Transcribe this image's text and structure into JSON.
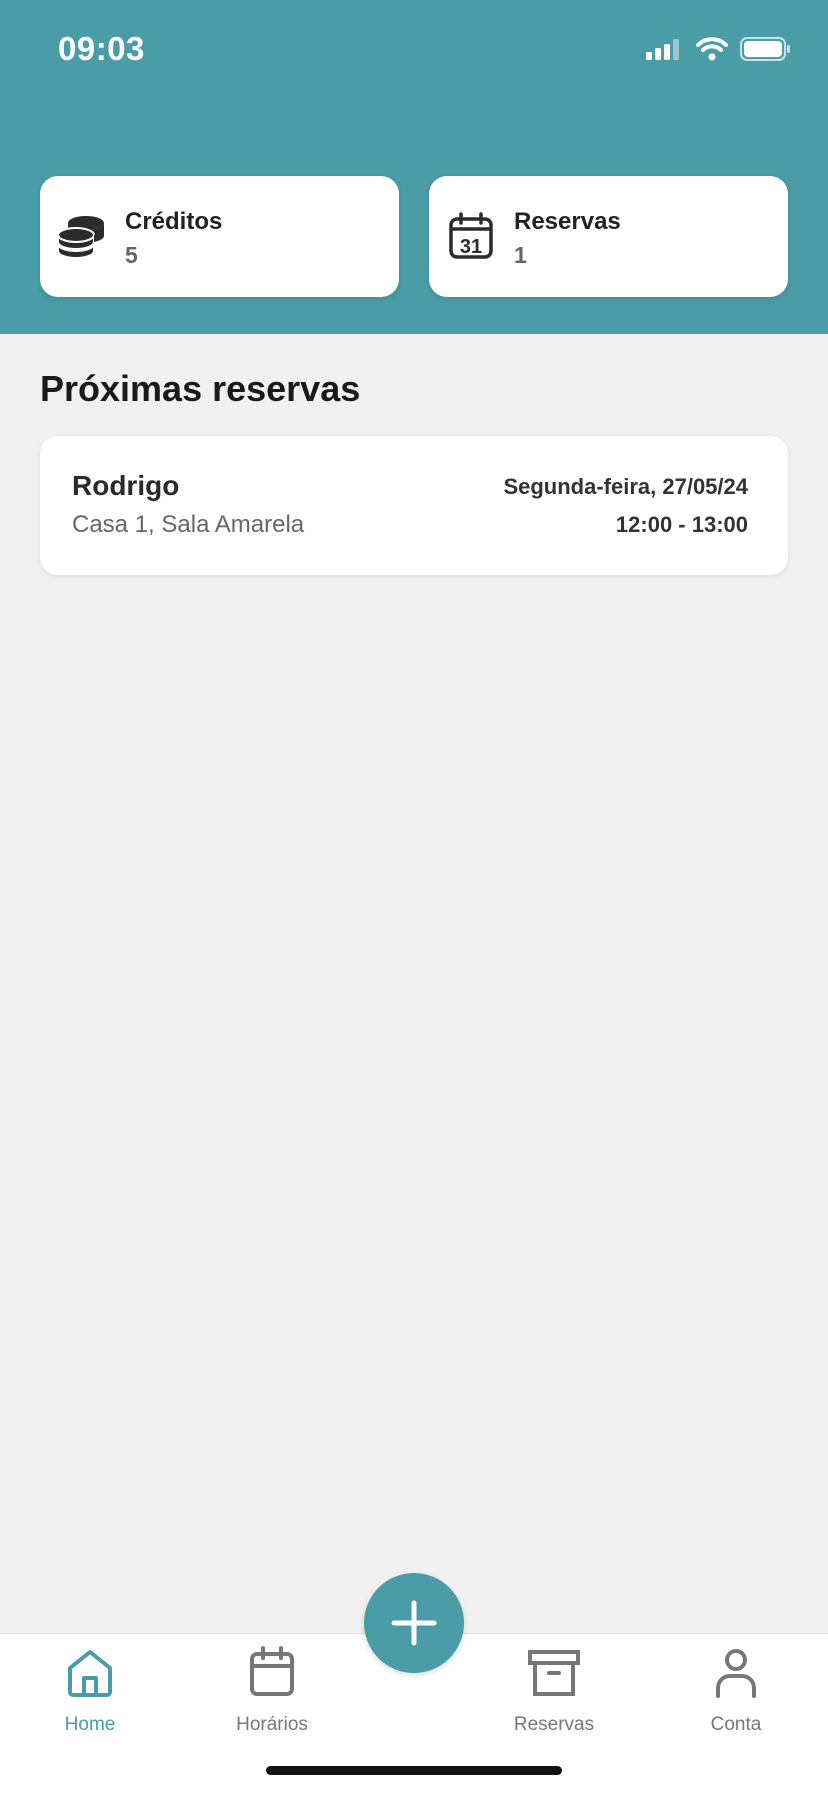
{
  "status_bar": {
    "time": "09:03"
  },
  "summary": {
    "credits": {
      "label": "Créditos",
      "value": "5",
      "icon": "coins-stack-icon"
    },
    "bookings": {
      "label": "Reservas",
      "value": "1",
      "icon": "calendar-31-icon"
    }
  },
  "section": {
    "title": "Próximas reservas"
  },
  "upcoming": [
    {
      "name": "Rodrigo",
      "place": "Casa 1, Sala Amarela",
      "date": "Segunda-feira, 27/05/24",
      "time": "12:00 - 13:00"
    }
  ],
  "tabbar": {
    "items": [
      {
        "label": "Home",
        "icon": "home-icon",
        "active": true
      },
      {
        "label": "Horários",
        "icon": "calendar-icon",
        "active": false
      },
      {
        "label": "Reservas",
        "icon": "archive-box-icon",
        "active": false
      },
      {
        "label": "Conta",
        "icon": "user-icon",
        "active": false
      }
    ],
    "fab_icon": "plus-icon"
  },
  "colors": {
    "accent": "#4a9ca7",
    "background": "#f1f1f2"
  }
}
